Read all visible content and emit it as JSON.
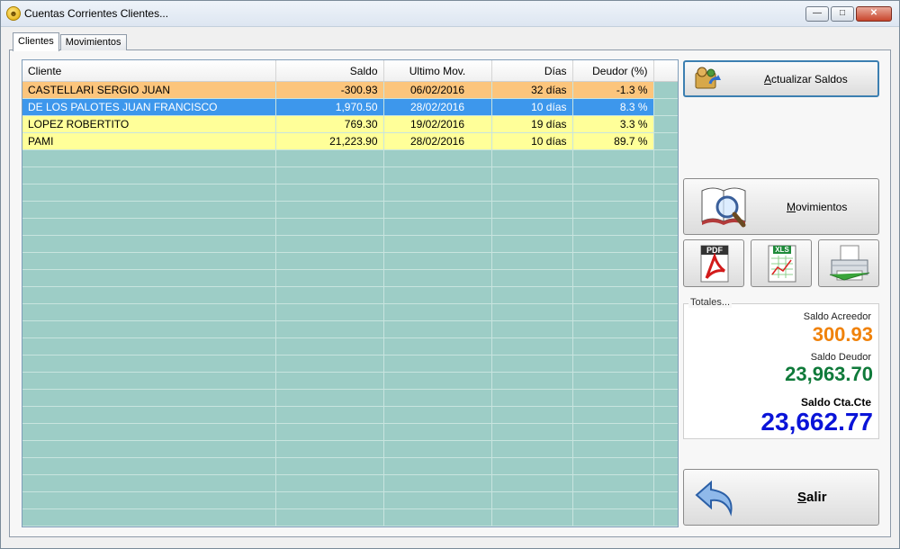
{
  "window": {
    "title": "Cuentas Corrientes Clientes..."
  },
  "tabs": [
    {
      "label": "Clientes",
      "active": true
    },
    {
      "label": "Movimientos",
      "active": false
    }
  ],
  "grid": {
    "columns": [
      "Cliente",
      "Saldo",
      "Ultimo Mov.",
      "Días",
      "Deudor (%)"
    ],
    "rows": [
      {
        "cliente": "CASTELLARI SERGIO JUAN",
        "saldo": "-300.93",
        "ultimo": "06/02/2016",
        "dias": "32 días",
        "deudor": "-1.3 %",
        "style": "orange"
      },
      {
        "cliente": "DE LOS PALOTES JUAN FRANCISCO",
        "saldo": "1,970.50",
        "ultimo": "28/02/2016",
        "dias": "10 días",
        "deudor": "8.3 %",
        "style": "selected"
      },
      {
        "cliente": "LOPEZ ROBERTITO",
        "saldo": "769.30",
        "ultimo": "19/02/2016",
        "dias": "19 días",
        "deudor": "3.3 %",
        "style": "yellow"
      },
      {
        "cliente": "PAMI",
        "saldo": "21,223.90",
        "ultimo": "28/02/2016",
        "dias": "10 días",
        "deudor": "89.7 %",
        "style": "yellow"
      }
    ]
  },
  "buttons": {
    "update_label_accel": "A",
    "update_label_rest": "ctualizar Saldos",
    "mov_label_accel": "M",
    "mov_label_rest": "ovimientos",
    "pdf_badge": "PDF",
    "xls_badge": "XLS",
    "salir_accel": "S",
    "salir_rest": "alir"
  },
  "totals": {
    "legend": "Totales...",
    "acreedor_label": "Saldo Acreedor",
    "acreedor_value": "300.93",
    "deudor_label": "Saldo Deudor",
    "deudor_value": "23,963.70",
    "ctacte_label": "Saldo Cta.Cte",
    "ctacte_value": "23,662.77"
  },
  "icons": {
    "app": "smiley-icon",
    "update": "users-refresh-icon",
    "movimientos": "book-magnifier-icon",
    "pdf": "pdf-icon",
    "xls": "spreadsheet-icon",
    "print": "printer-icon",
    "salir": "back-arrow-icon"
  },
  "colors": {
    "acreedor": "#f0820a",
    "deudor": "#0f7a3a",
    "ctacte": "#0a14d8",
    "row_orange": "#fcc57c",
    "row_selected": "#3d97ec",
    "row_yellow": "#ffff99",
    "grid_bg": "#9dcdc6"
  }
}
